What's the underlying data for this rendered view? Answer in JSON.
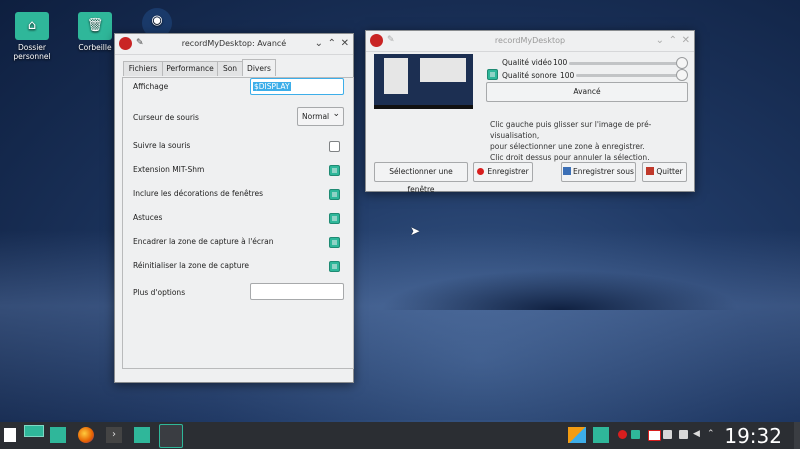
{
  "desktop": {
    "icons": [
      {
        "label": "Dossier personnel",
        "icon": "home-folder-icon"
      },
      {
        "label": "Corbeille",
        "icon": "trash-icon"
      },
      {
        "label": "",
        "icon": "steam-icon"
      }
    ]
  },
  "advanced_window": {
    "title": "recordMyDesktop: Avancé",
    "tabs": [
      "Fichiers",
      "Performance",
      "Son",
      "Divers"
    ],
    "active_tab": "Divers",
    "display_label": "Affichage",
    "display_value": "$DISPLAY",
    "cursor_label": "Curseur de souris",
    "cursor_value": "Normal",
    "options": [
      {
        "label": "Suivre la souris",
        "checked": false
      },
      {
        "label": "Extension MIT-Shm",
        "checked": true
      },
      {
        "label": "Inclure les décorations de fenêtres",
        "checked": true
      },
      {
        "label": "Astuces",
        "checked": true
      },
      {
        "label": "Encadrer la zone de capture à l'écran",
        "checked": true
      },
      {
        "label": "Réinitialiser la zone de capture",
        "checked": true
      }
    ],
    "more_options_label": "Plus d'options",
    "more_options_value": ""
  },
  "main_window": {
    "title": "recordMyDesktop",
    "video_quality_label": "Qualité vidéo",
    "video_quality_value": "100",
    "sound_quality_label": "Qualité sonore",
    "sound_quality_value": "100",
    "sound_enabled": true,
    "advanced_button": "Avancé",
    "instructions": [
      "Clic gauche puis glisser sur l'image de pré-visualisation,",
      "pour sélectionner une zone à enregistrer.",
      "Clic droit dessus pour annuler la sélection."
    ],
    "buttons": {
      "select_window": "Sélectionner une fenêtre",
      "record": "Enregistrer",
      "save_as": "Enregistrer sous",
      "quit": "Quitter"
    }
  },
  "taskbar": {
    "clock": "19:32"
  },
  "colors": {
    "accent": "#2fb79a",
    "focus": "#3daee9",
    "taskbar": "#2b2e33"
  }
}
